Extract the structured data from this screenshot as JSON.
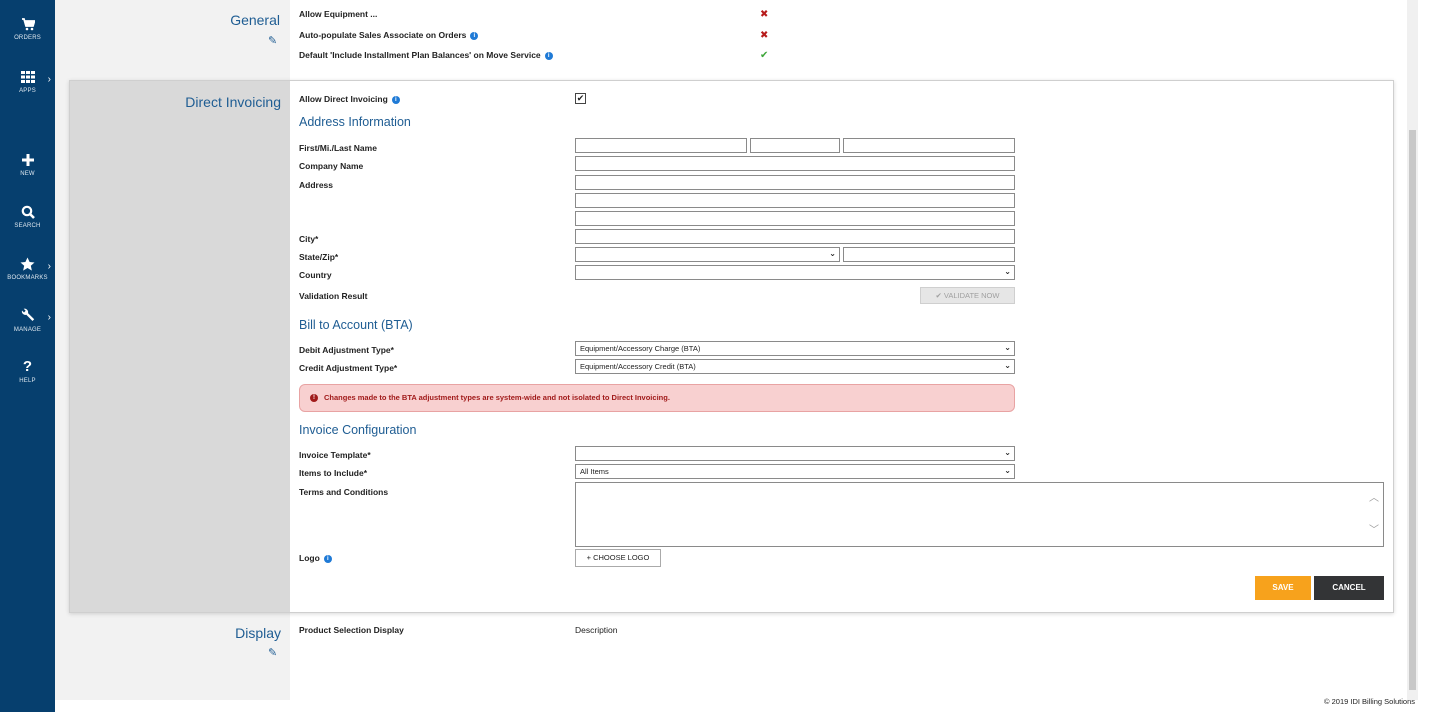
{
  "nav": [
    {
      "label": "ORDERS",
      "icon": "cart-icon",
      "chevron": false
    },
    {
      "label": "APPS",
      "icon": "grid-icon",
      "chevron": true
    },
    {
      "label": "NEW",
      "icon": "plus-icon",
      "chevron": false
    },
    {
      "label": "SEARCH",
      "icon": "search-icon",
      "chevron": false
    },
    {
      "label": "BOOKMARKS",
      "icon": "star-icon",
      "chevron": true
    },
    {
      "label": "MANAGE",
      "icon": "wrench-icon",
      "chevron": true
    },
    {
      "label": "HELP",
      "icon": "question-icon",
      "chevron": false
    }
  ],
  "chevron": "›",
  "general": {
    "title": "General",
    "rows": [
      {
        "label": "Allow Equipment ...",
        "value": "✖",
        "status": "disabled"
      },
      {
        "label": "Auto-populate Sales Associate on Orders",
        "value": "✖",
        "status": "disabled"
      },
      {
        "label": "Default 'Include Installment Plan Balances' on Move Service",
        "value": "✔",
        "status": "enabled"
      }
    ]
  },
  "direct_invoicing": {
    "title": "Direct Invoicing",
    "allow_label": "Allow Direct Invoicing",
    "allow_checked": "✔",
    "address": {
      "heading": "Address Information",
      "name_label": "First/Mi./Last Name",
      "company_label": "Company Name",
      "address_label": "Address",
      "city_label": "City*",
      "state_zip_label": "State/Zip*",
      "country_label": "Country",
      "validation_label": "Validation Result",
      "validate_button": "✔ VALIDATE NOW"
    },
    "bta": {
      "heading": "Bill to Account (BTA)",
      "debit_label": "Debit Adjustment Type*",
      "debit_value": "Equipment/Accessory Charge (BTA)",
      "credit_label": "Credit Adjustment Type*",
      "credit_value": "Equipment/Accessory Credit (BTA)",
      "alert": "Changes made to the BTA adjustment types are system-wide and not isolated to Direct Invoicing."
    },
    "invoice": {
      "heading": "Invoice Configuration",
      "template_label": "Invoice Template*",
      "template_value": "",
      "items_label": "Items to Include*",
      "items_value": "All Items",
      "terms_label": "Terms and Conditions",
      "logo_label": "Logo",
      "choose_logo": "+ CHOOSE LOGO"
    },
    "save": "SAVE",
    "cancel": "CANCEL"
  },
  "display": {
    "title": "Display",
    "label": "Product Selection Display",
    "value": "Description"
  },
  "footer": "© 2019 IDI Billing Solutions",
  "colors": {
    "accent": "#1f5d93",
    "sidebar": "#063f6e",
    "save": "#f7a21c",
    "cancel": "#333436",
    "alert_bg": "#f8d0d0"
  }
}
